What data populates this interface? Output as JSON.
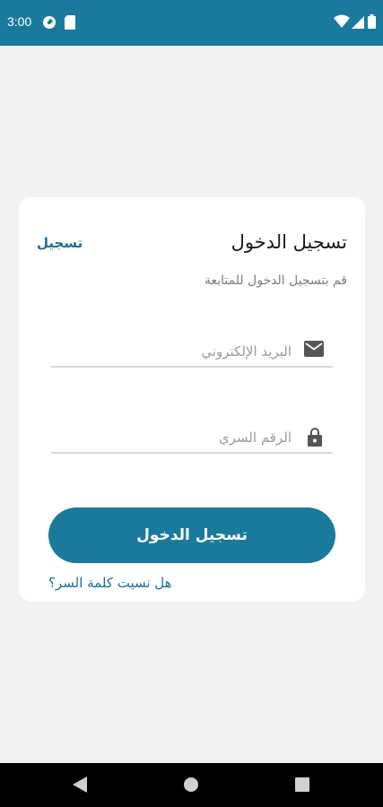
{
  "status_bar": {
    "time": "3:00",
    "left_icons": [
      "data-saver-icon",
      "sd-card-icon"
    ],
    "right_icons": [
      "wifi-icon",
      "signal-icon",
      "battery-icon"
    ],
    "background": "#1a7a9e"
  },
  "login_card": {
    "title": "تسجيل الدخول",
    "register_link": "تسجيل",
    "subtitle": "قم بتسجيل الدخول للمتابعة",
    "email_field": {
      "placeholder": "البريد الإلكتروني",
      "value": "",
      "icon": "email-icon"
    },
    "password_field": {
      "placeholder": "الرقم السري",
      "value": "",
      "icon": "lock-icon"
    },
    "login_button": "تسجيل الدخول",
    "forgot_password": "هل نسيت كلمة السر؟"
  },
  "nav_bar": {
    "buttons": [
      "back-icon",
      "home-icon",
      "recents-icon"
    ]
  },
  "colors": {
    "primary": "#1a7a9e",
    "link": "#1f6f97",
    "background": "#f2f2f2",
    "card": "#ffffff"
  }
}
